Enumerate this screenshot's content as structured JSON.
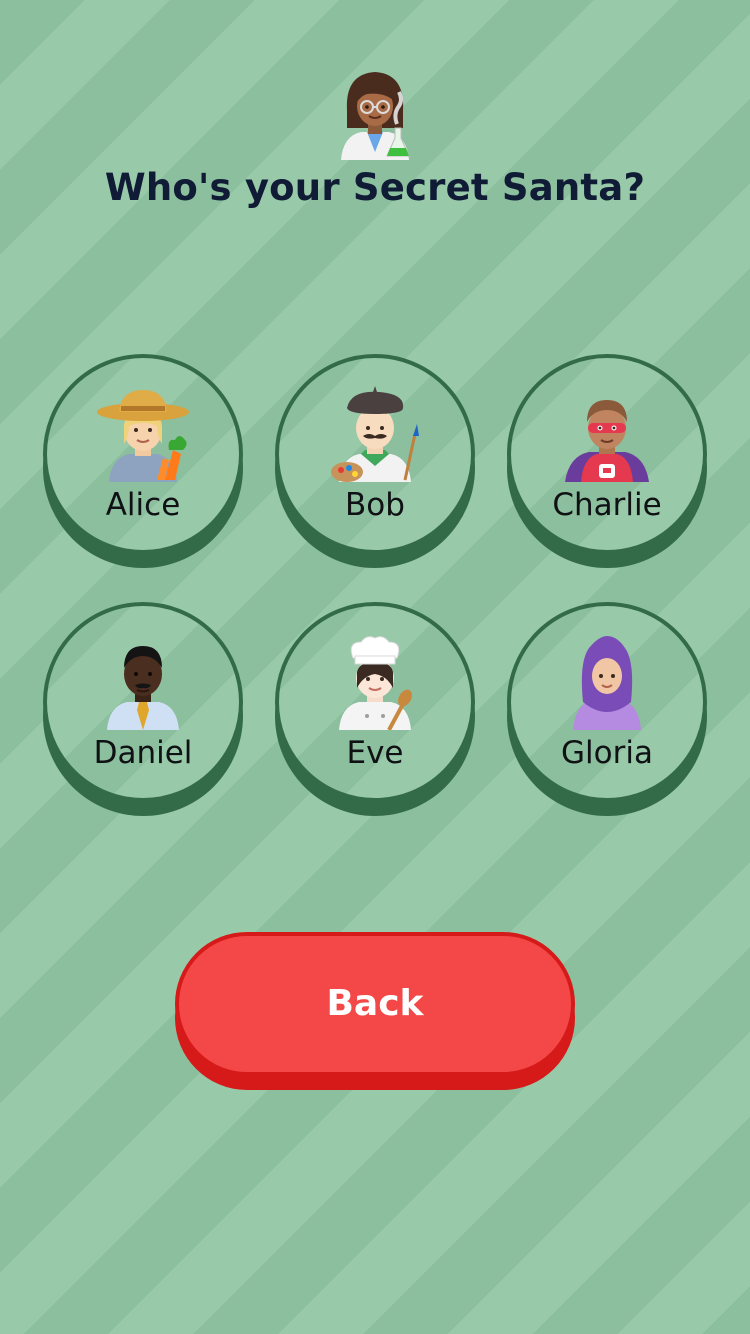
{
  "header": {
    "avatar_icon": "woman-scientist-icon",
    "title": "Who's your Secret Santa?"
  },
  "people": [
    {
      "name": "Alice",
      "icon": "farmer-icon"
    },
    {
      "name": "Bob",
      "icon": "artist-icon"
    },
    {
      "name": "Charlie",
      "icon": "superhero-icon"
    },
    {
      "name": "Daniel",
      "icon": "office-worker-icon"
    },
    {
      "name": "Eve",
      "icon": "cook-icon"
    },
    {
      "name": "Gloria",
      "icon": "woman-with-headscarf-icon"
    }
  ],
  "back_button": {
    "label": "Back"
  },
  "colors": {
    "background": "#8cbf9d",
    "background_stripe": "#98c9a8",
    "ring": "#336b49",
    "title": "#101c35",
    "back_button": "#f44848",
    "back_button_edge": "#d61a1a"
  }
}
